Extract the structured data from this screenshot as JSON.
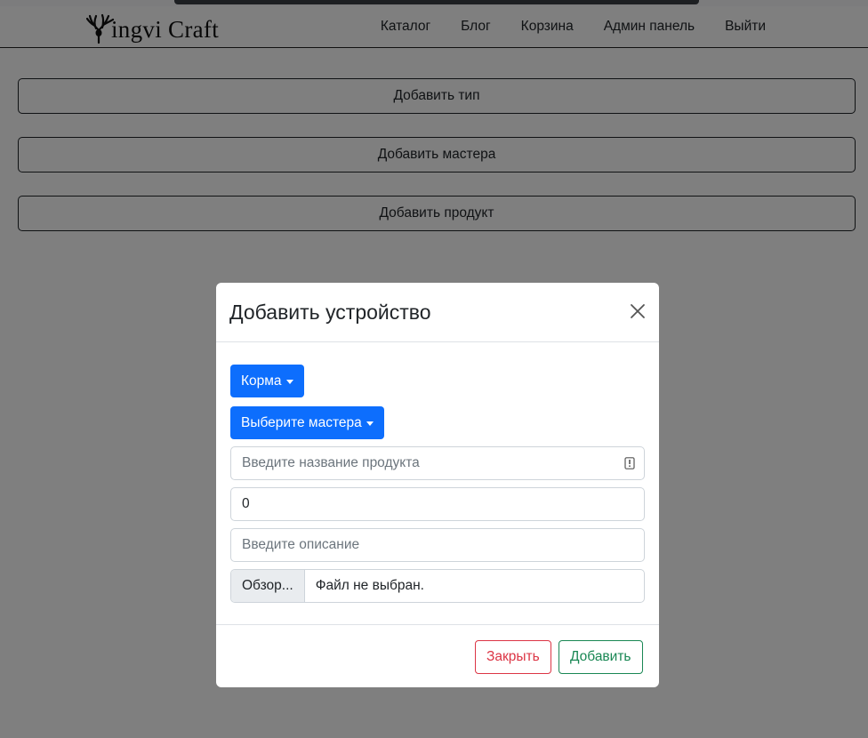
{
  "navbar": {
    "brand": "ingvi Craft",
    "links": [
      "Каталог",
      "Блог",
      "Корзина",
      "Админ панель",
      "Выйти"
    ]
  },
  "page": {
    "buttons": [
      "Добавить тип",
      "Добавить мастера",
      "Добавить продукт"
    ]
  },
  "modal": {
    "title": "Добавить устройство",
    "type_dropdown_label": "Корма",
    "master_dropdown_label": "Выберите мастера",
    "name_field": {
      "value": "",
      "placeholder": "Введите название продукта"
    },
    "price_field": {
      "value": "0",
      "placeholder": ""
    },
    "description_field": {
      "value": "",
      "placeholder": "Введите описание"
    },
    "file_input": {
      "button_label": "Обзор...",
      "status": "Файл не выбран."
    },
    "close_label": "Закрыть",
    "add_label": "Добавить"
  },
  "colors": {
    "primary": "#0d6efd",
    "danger": "#dc3545",
    "success": "#198754",
    "backdrop": "rgba(0,0,0,0.5)"
  },
  "icons": {
    "brand": "deer-antlers-icon",
    "close": "close-icon",
    "autofill": "password-manager-icon",
    "dropdown": "caret-down-icon"
  }
}
